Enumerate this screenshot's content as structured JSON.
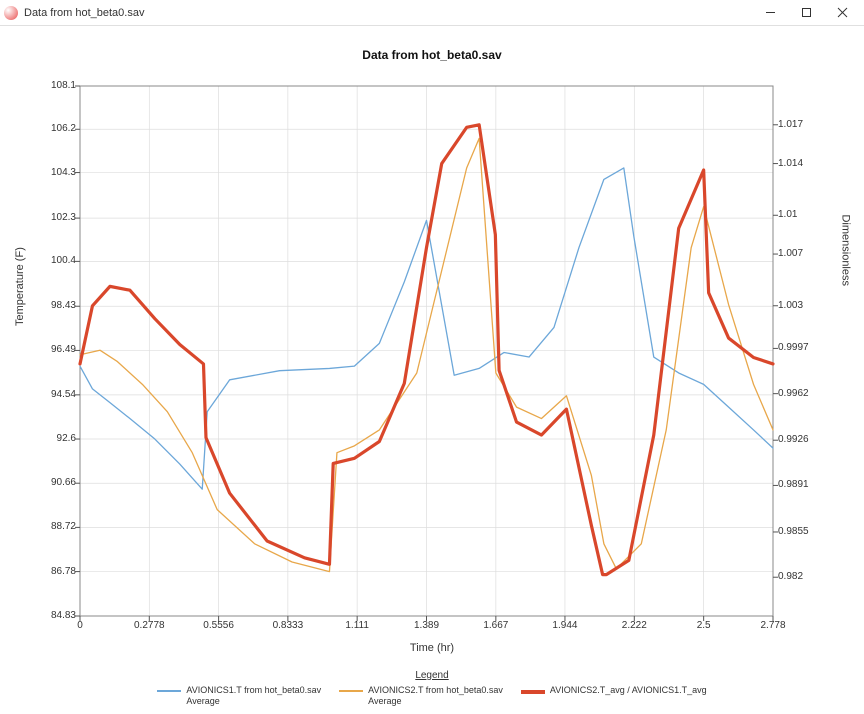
{
  "window": {
    "title": "Data from hot_beta0.sav"
  },
  "chart": {
    "title": "Data from hot_beta0.sav",
    "xlabel": "Time (hr)",
    "ylabel_left": "Temperature (F)",
    "ylabel_right": "Dimensionless",
    "legend_title": "Legend",
    "legend": [
      {
        "label_line1": "AVIONICS1.T from hot_beta0.sav",
        "label_line2": "Average",
        "color": "#6ca7d9",
        "thick": false
      },
      {
        "label_line1": "AVIONICS2.T from hot_beta0.sav",
        "label_line2": "Average",
        "color": "#e8a74a",
        "thick": false
      },
      {
        "label_line1": "AVIONICS2.T_avg / AVIONICS1.T_avg",
        "label_line2": "",
        "color": "#d9472b",
        "thick": true
      }
    ]
  },
  "chart_data": {
    "type": "line",
    "xlabel": "Time (hr)",
    "ylabel_left": "Temperature (F)",
    "ylabel_right": "Dimensionless",
    "title": "Data from hot_beta0.sav",
    "x_ticks": [
      0,
      0.2778,
      0.5556,
      0.8333,
      1.111,
      1.389,
      1.667,
      1.944,
      2.222,
      2.5,
      2.778
    ],
    "y_left_ticks": [
      84.83,
      86.78,
      88.72,
      90.66,
      92.6,
      94.54,
      96.49,
      98.43,
      100.4,
      102.3,
      104.3,
      106.2,
      108.1
    ],
    "y_right_ticks": [
      0.982,
      0.9855,
      0.9891,
      0.9926,
      0.9962,
      0.9997,
      1.003,
      1.007,
      1.01,
      1.014,
      1.017
    ],
    "xlim": [
      0,
      2.778
    ],
    "ylim_left": [
      84.83,
      108.1
    ],
    "ylim_right": [
      0.979,
      1.02
    ],
    "series": [
      {
        "name": "AVIONICS1.T from hot_beta0.sav Average",
        "axis": "left",
        "color": "#6ca7d9",
        "x": [
          0,
          0.05,
          0.12,
          0.2,
          0.3,
          0.4,
          0.49,
          0.51,
          0.6,
          0.8,
          1.0,
          1.1,
          1.2,
          1.3,
          1.389,
          1.5,
          1.6,
          1.7,
          1.8,
          1.9,
          2.0,
          2.1,
          2.18,
          2.22,
          2.3,
          2.4,
          2.5,
          2.6,
          2.7,
          2.778
        ],
        "values": [
          95.8,
          94.8,
          94.2,
          93.5,
          92.6,
          91.5,
          90.4,
          93.8,
          95.2,
          95.6,
          95.7,
          95.8,
          96.8,
          99.5,
          102.2,
          95.4,
          95.7,
          96.4,
          96.2,
          97.5,
          101.0,
          104.0,
          104.5,
          101.5,
          96.2,
          95.5,
          95.0,
          94.0,
          93.0,
          92.2
        ]
      },
      {
        "name": "AVIONICS2.T from hot_beta0.sav Average",
        "axis": "left",
        "color": "#e8a74a",
        "x": [
          0,
          0.08,
          0.15,
          0.25,
          0.35,
          0.45,
          0.55,
          0.7,
          0.85,
          1.0,
          1.03,
          1.1,
          1.2,
          1.35,
          1.45,
          1.55,
          1.6,
          1.667,
          1.75,
          1.85,
          1.95,
          2.05,
          2.1,
          2.15,
          2.25,
          2.35,
          2.45,
          2.5,
          2.6,
          2.7,
          2.778
        ],
        "values": [
          96.3,
          96.5,
          96.0,
          95.0,
          93.8,
          92.0,
          89.5,
          88.0,
          87.2,
          86.78,
          92.0,
          92.3,
          93.0,
          95.5,
          100.0,
          104.5,
          105.8,
          95.5,
          94.0,
          93.5,
          94.5,
          91.0,
          88.0,
          86.9,
          88.0,
          93.0,
          101.0,
          102.8,
          98.5,
          95.0,
          93.0
        ]
      },
      {
        "name": "AVIONICS2.T_avg / AVIONICS1.T_avg",
        "axis": "right",
        "color": "#d9472b",
        "x": [
          0,
          0.05,
          0.12,
          0.2,
          0.3,
          0.4,
          0.495,
          0.505,
          0.6,
          0.75,
          0.9,
          1.0,
          1.015,
          1.1,
          1.2,
          1.3,
          1.389,
          1.45,
          1.55,
          1.6,
          1.665,
          1.68,
          1.75,
          1.85,
          1.95,
          2.05,
          2.095,
          2.11,
          2.2,
          2.3,
          2.4,
          2.5,
          2.52,
          2.6,
          2.7,
          2.778
        ],
        "values": [
          0.9985,
          1.003,
          1.0045,
          1.0042,
          1.002,
          1.0,
          0.9985,
          0.9928,
          0.9885,
          0.9848,
          0.9835,
          0.983,
          0.9908,
          0.9912,
          0.9925,
          0.997,
          1.0075,
          1.014,
          1.0168,
          1.017,
          1.0085,
          0.998,
          0.994,
          0.993,
          0.995,
          0.986,
          0.9822,
          0.9822,
          0.9833,
          0.993,
          1.009,
          1.0135,
          1.004,
          1.0005,
          0.999,
          0.9985
        ]
      }
    ]
  }
}
